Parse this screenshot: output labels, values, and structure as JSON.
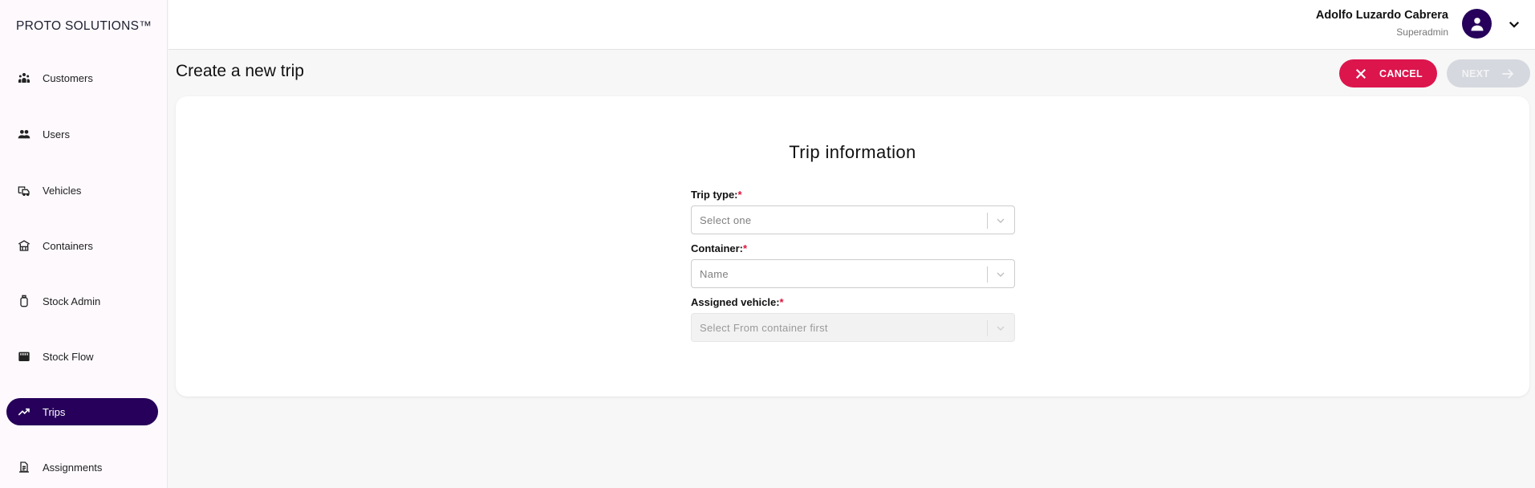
{
  "sidebar": {
    "brand": "PROTO SOLUTIONS™",
    "items": [
      {
        "label": "Customers",
        "icon": "customers-icon",
        "active": false
      },
      {
        "label": "Users",
        "icon": "users-icon",
        "active": false
      },
      {
        "label": "Vehicles",
        "icon": "vehicles-icon",
        "active": false
      },
      {
        "label": "Containers",
        "icon": "containers-icon",
        "active": false
      },
      {
        "label": "Stock Admin",
        "icon": "stock-admin-icon",
        "active": false
      },
      {
        "label": "Stock Flow",
        "icon": "stock-flow-icon",
        "active": false
      },
      {
        "label": "Trips",
        "icon": "trips-icon",
        "active": true
      },
      {
        "label": "Assignments",
        "icon": "assignments-icon",
        "active": false
      }
    ]
  },
  "header": {
    "user_name": "Adolfo Luzardo Cabrera",
    "user_role": "Superadmin",
    "avatar_icon": "user-avatar-icon",
    "menu_icon": "chevron-down-icon"
  },
  "page": {
    "title": "Create a new trip",
    "cancel_label": "CANCEL",
    "next_label": "NEXT",
    "next_disabled": true
  },
  "form": {
    "title": "Trip information",
    "required_mark": "*",
    "fields": [
      {
        "label": "Trip type:",
        "placeholder": "Select one",
        "disabled": false
      },
      {
        "label": "Container:",
        "placeholder": "Name",
        "disabled": false
      },
      {
        "label": "Assigned vehicle:",
        "placeholder": "Select From container first",
        "disabled": true
      }
    ]
  },
  "colors": {
    "brand_dark": "#26005a",
    "cancel": "#dc154d",
    "next_disabled": "#d5d8de",
    "required": "#dc143c"
  }
}
